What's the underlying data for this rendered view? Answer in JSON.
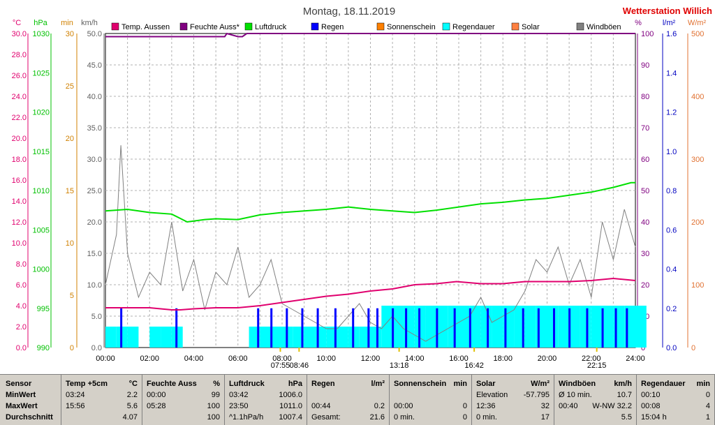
{
  "header": {
    "title": "Montag, 18.11.2019",
    "station": "Wetterstation Willich"
  },
  "axes": {
    "left_units": [
      "°C",
      "hPa",
      "min",
      "km/h"
    ],
    "right_units": [
      "%",
      "l/m²",
      "W/m²"
    ],
    "temp_ticks": [
      "30.0",
      "28.0",
      "26.0",
      "24.0",
      "22.0",
      "20.0",
      "18.0",
      "16.0",
      "14.0",
      "12.0",
      "10.0",
      "8.0",
      "6.0",
      "4.0",
      "2.0",
      "0.0"
    ],
    "hpa_ticks": [
      "1030",
      "1025",
      "1020",
      "1015",
      "1010",
      "1005",
      "1000",
      "995",
      "990"
    ],
    "min_ticks": [
      "30",
      "25",
      "20",
      "15",
      "10",
      "5",
      "0"
    ],
    "kmh_ticks": [
      "50.0",
      "45.0",
      "40.0",
      "35.0",
      "30.0",
      "25.0",
      "20.0",
      "15.0",
      "10.0",
      "5.0",
      "0.0"
    ],
    "pct_ticks": [
      "100",
      "90",
      "80",
      "70",
      "60",
      "50",
      "40",
      "30",
      "20",
      "10",
      "0"
    ],
    "lm2_ticks": [
      "1.6",
      "1.4",
      "1.2",
      "1.0",
      "0.8",
      "0.6",
      "0.4",
      "0.2",
      "0.0"
    ],
    "wm2_ticks": [
      "500",
      "400",
      "300",
      "200",
      "100",
      "0"
    ],
    "x_ticks": [
      "00:00",
      "02:00",
      "04:00",
      "06:00",
      "08:00",
      "10:00",
      "12:00",
      "14:00",
      "16:00",
      "18:00",
      "20:00",
      "22:00",
      "24:00"
    ]
  },
  "sun_markers": [
    {
      "label": "08:46",
      "hour": 8.77
    },
    {
      "label": "07:55",
      "hour": 7.92
    },
    {
      "label": "13:18",
      "hour": 13.3
    },
    {
      "label": "16:42",
      "hour": 16.7
    },
    {
      "label": "22:15",
      "hour": 22.25
    }
  ],
  "legend": [
    {
      "label": "Temp. Aussen",
      "color": "#e0006e"
    },
    {
      "label": "Feuchte Auss*",
      "color": "#800080"
    },
    {
      "label": "Luftdruck",
      "color": "#00e000"
    },
    {
      "label": "Regen",
      "color": "#0000ff"
    },
    {
      "label": "Sonnenschein",
      "color": "#ff8000"
    },
    {
      "label": "Regendauer",
      "color": "#00ffff"
    },
    {
      "label": "Solar",
      "color": "#ff8040"
    },
    {
      "label": "Windböen",
      "color": "#808080"
    }
  ],
  "chart_data": {
    "type": "line",
    "x_range": [
      0,
      24
    ],
    "series": [
      {
        "name": "Temp. Aussen",
        "unit": "°C",
        "color": "#e0006e",
        "x": [
          0,
          1,
          2,
          3,
          3.4,
          4,
          5,
          6,
          7,
          8,
          9,
          10,
          11,
          12,
          13,
          14,
          15,
          15.9,
          17,
          18,
          19,
          20,
          21,
          22,
          23,
          24
        ],
        "values": [
          3.8,
          3.8,
          3.8,
          3.6,
          3.6,
          3.7,
          3.8,
          3.8,
          4.0,
          4.3,
          4.6,
          4.9,
          5.1,
          5.4,
          5.6,
          6.0,
          6.1,
          6.3,
          6.1,
          6.1,
          6.3,
          6.3,
          6.3,
          6.4,
          6.6,
          6.4
        ]
      },
      {
        "name": "Feuchte Auss*",
        "unit": "%",
        "color": "#800080",
        "x": [
          0,
          5.4,
          5.5,
          6.0,
          6.2,
          6.4,
          6.6,
          24
        ],
        "values": [
          99,
          99,
          100,
          99,
          99,
          100,
          100,
          100
        ]
      },
      {
        "name": "Luftdruck",
        "unit": "hPa",
        "color": "#00e000",
        "x": [
          0,
          1,
          2,
          3,
          3.7,
          4.5,
          5,
          6,
          7,
          8,
          9,
          10,
          11,
          12,
          13,
          14,
          15,
          16,
          17,
          18,
          19,
          20,
          21,
          22,
          23,
          23.8,
          24
        ],
        "values": [
          1007.4,
          1007.6,
          1007.2,
          1007.0,
          1006.0,
          1006.3,
          1006.4,
          1006.3,
          1006.9,
          1007.2,
          1007.4,
          1007.6,
          1007.9,
          1007.6,
          1007.4,
          1007.2,
          1007.5,
          1007.9,
          1008.3,
          1008.5,
          1008.8,
          1009.0,
          1009.4,
          1009.8,
          1010.4,
          1011.0,
          1011.0
        ]
      },
      {
        "name": "Regen",
        "unit": "l/m²",
        "color": "#0000ff",
        "x": [
          0.7,
          3.2,
          6.9,
          7.5,
          8.2,
          8.9,
          9.6,
          10.4,
          11.2,
          11.9,
          12.3,
          13.0,
          13.6,
          14.2,
          15.0,
          15.8,
          16.5,
          17.3,
          18.1,
          18.9,
          19.6,
          20.3,
          21.0,
          21.8,
          22.5,
          23.1,
          23.6
        ],
        "values": [
          0.2,
          0.2,
          0.2,
          0.2,
          0.2,
          0.2,
          0.2,
          0.2,
          0.2,
          0.2,
          0.2,
          0.2,
          0.2,
          0.2,
          0.2,
          0.2,
          0.2,
          0.2,
          0.2,
          0.2,
          0.2,
          0.2,
          0.2,
          0.2,
          0.2,
          0.2,
          0.2
        ]
      },
      {
        "name": "Regendauer",
        "unit": "min",
        "color": "#00ffff",
        "x": [
          0,
          0.5,
          1,
          1.5,
          2,
          2.5,
          3,
          3.5,
          4,
          4.5,
          5,
          5.5,
          6,
          6.5,
          7,
          7.5,
          8,
          8.5,
          9,
          9.5,
          10,
          10.5,
          11,
          11.5,
          12,
          12.5,
          13,
          13.5,
          14,
          14.5,
          15,
          15.5,
          16,
          16.5,
          17,
          17.5,
          18,
          18.5,
          19,
          19.5,
          20,
          20.5,
          21,
          21.5,
          22,
          22.5,
          23,
          23.5,
          24
        ],
        "values": [
          2,
          2,
          2,
          0,
          2,
          2,
          2,
          0,
          0,
          0,
          0,
          0,
          0,
          2,
          2,
          2,
          2,
          2,
          2,
          2,
          2,
          2,
          2,
          2,
          2,
          4,
          4,
          4,
          4,
          4,
          4,
          4,
          4,
          4,
          4,
          4,
          4,
          4,
          4,
          4,
          4,
          4,
          4,
          4,
          4,
          4,
          4,
          4,
          4
        ]
      },
      {
        "name": "Windböen",
        "unit": "km/h",
        "color": "#808080",
        "x": [
          0,
          0.5,
          0.7,
          1,
          1.5,
          2,
          2.5,
          3,
          3.5,
          4,
          4.5,
          5,
          5.5,
          6,
          6.5,
          7,
          7.5,
          8,
          8.5,
          9,
          9.5,
          10,
          10.5,
          11,
          11.5,
          12,
          12.5,
          13,
          13.5,
          14,
          14.5,
          15,
          15.5,
          16,
          16.5,
          17,
          17.5,
          18,
          18.5,
          19,
          19.5,
          20,
          20.5,
          21,
          21.5,
          22,
          22.5,
          23,
          23.5,
          24
        ],
        "values": [
          10,
          18,
          32.2,
          15,
          8,
          12,
          10,
          20,
          9,
          14,
          6,
          12,
          10,
          16,
          8,
          10,
          14,
          7,
          6,
          5,
          4,
          3,
          3,
          5,
          7,
          4,
          3,
          5,
          3,
          2,
          1,
          2,
          3,
          4,
          5,
          8,
          4,
          5,
          6,
          9,
          14,
          12,
          16,
          10,
          14,
          8,
          20,
          14,
          22,
          16
        ]
      }
    ]
  },
  "stats": {
    "rows": [
      "Sensor",
      "MinWert",
      "MaxWert",
      "Durchschnitt"
    ],
    "columns": [
      {
        "title": "Temp +5cm",
        "unit": "°C",
        "cells": [
          [
            "03:24",
            "2.2"
          ],
          [
            "15:56",
            "5.6"
          ],
          [
            "",
            "4.07"
          ]
        ]
      },
      {
        "title": "Feuchte Auss",
        "unit": "%",
        "cells": [
          [
            "00:00",
            "99"
          ],
          [
            "05:28",
            "100"
          ],
          [
            "",
            "100"
          ]
        ]
      },
      {
        "title": "Luftdruck",
        "unit": "hPa",
        "cells": [
          [
            "03:42",
            "1006.0"
          ],
          [
            "23:50",
            "1011.0"
          ],
          [
            "^1.1hPa/h",
            "1007.4"
          ]
        ]
      },
      {
        "title": "Regen",
        "unit": "l/m²",
        "cells": [
          [
            "",
            ""
          ],
          [
            "00:44",
            "0.2"
          ],
          [
            "Gesamt:",
            "21.6"
          ]
        ]
      },
      {
        "title": "Sonnenschein",
        "unit": "min",
        "cells": [
          [
            "",
            ""
          ],
          [
            "00:00",
            "0"
          ],
          [
            "0 min.",
            "0"
          ]
        ]
      },
      {
        "title": "Solar",
        "unit": "W/m²",
        "cells": [
          [
            "Elevation",
            "-57.795"
          ],
          [
            "12:36",
            "32"
          ],
          [
            "0 min.",
            "17"
          ]
        ]
      },
      {
        "title": "Windböen",
        "unit": "km/h",
        "cells": [
          [
            "Ø 10 min.",
            "10.7"
          ],
          [
            "00:40",
            "W-NW 32.2"
          ],
          [
            "",
            "5.5"
          ]
        ]
      },
      {
        "title": "Regendauer",
        "unit": "min",
        "cells": [
          [
            "00:10",
            "0"
          ],
          [
            "00:08",
            "4"
          ],
          [
            "15:04 h",
            "1"
          ]
        ]
      }
    ]
  }
}
